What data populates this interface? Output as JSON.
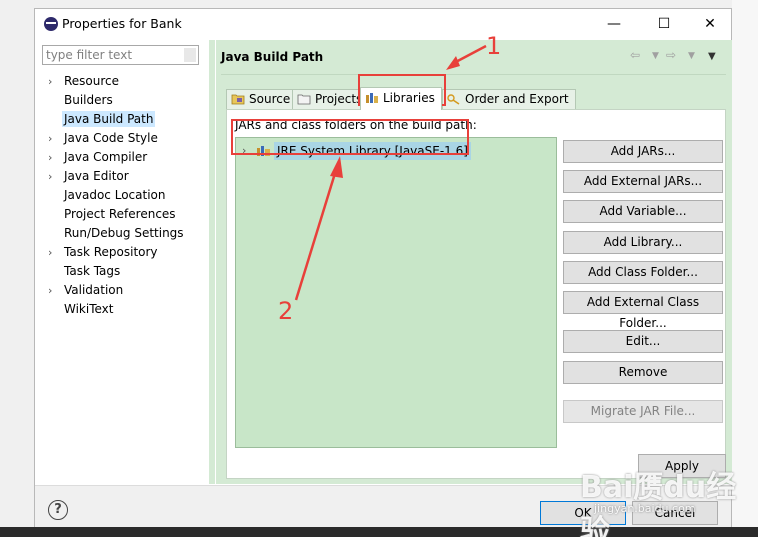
{
  "window": {
    "title": "Properties for Bank",
    "minimize": "—",
    "maximize": "☐",
    "close": "✕"
  },
  "nav": {
    "filter_placeholder": "type filter text",
    "items": [
      {
        "label": "Resource",
        "expandable": true
      },
      {
        "label": "Builders",
        "expandable": false
      },
      {
        "label": "Java Build Path",
        "expandable": false,
        "selected": true
      },
      {
        "label": "Java Code Style",
        "expandable": true
      },
      {
        "label": "Java Compiler",
        "expandable": true
      },
      {
        "label": "Java Editor",
        "expandable": true
      },
      {
        "label": "Javadoc Location",
        "expandable": false
      },
      {
        "label": "Project References",
        "expandable": false
      },
      {
        "label": "Run/Debug Settings",
        "expandable": false
      },
      {
        "label": "Task Repository",
        "expandable": true
      },
      {
        "label": "Task Tags",
        "expandable": false
      },
      {
        "label": "Validation",
        "expandable": true
      },
      {
        "label": "WikiText",
        "expandable": false
      }
    ]
  },
  "content": {
    "title": "Java Build Path",
    "tabs": [
      {
        "label": "Source",
        "icon": "source-folder-icon"
      },
      {
        "label": "Projects",
        "icon": "projects-icon"
      },
      {
        "label": "Libraries",
        "icon": "libraries-icon",
        "active": true
      },
      {
        "label": "Order and Export",
        "icon": "order-export-icon"
      }
    ],
    "list_label": "JARs and class folders on the build path:",
    "library_entry": "JRE System Library [JavaSE-1.6]",
    "buttons": {
      "add_jars": "Add JARs...",
      "add_external_jars": "Add External JARs...",
      "add_variable": "Add Variable...",
      "add_library": "Add Library...",
      "add_class_folder": "Add Class Folder...",
      "add_external_class_folder": "Add External Class Folder...",
      "edit": "Edit...",
      "remove": "Remove",
      "migrate_jar": "Migrate JAR File..."
    },
    "apply": "Apply"
  },
  "footer": {
    "help": "?",
    "ok": "OK",
    "cancel": "Cancel"
  },
  "annotations": {
    "label_1": "1",
    "label_2": "2",
    "color": "#e8403a"
  },
  "watermark": {
    "text": "Bai赝du经验",
    "sub": "jingyan.baidu.com"
  },
  "colors": {
    "content_bg": "#d4ead4",
    "list_bg": "#c8e6c8",
    "selection": "#cce8ff",
    "entry_highlight": "#a9d5e5"
  }
}
